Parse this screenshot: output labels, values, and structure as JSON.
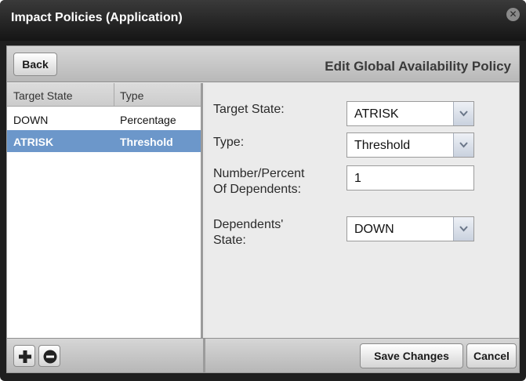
{
  "window": {
    "title": "Impact Policies (Application)",
    "close_icon": "close-icon"
  },
  "toolbar": {
    "back_label": "Back",
    "header_title": "Edit Global Availability Policy"
  },
  "policy_list": {
    "columns": [
      "Target State",
      "Type"
    ],
    "rows": [
      {
        "target_state": "DOWN",
        "type": "Percentage",
        "selected": false
      },
      {
        "target_state": "ATRISK",
        "type": "Threshold",
        "selected": true
      }
    ]
  },
  "form": {
    "target_state": {
      "label": "Target State:",
      "value": "ATRISK"
    },
    "type": {
      "label": "Type:",
      "value": "Threshold"
    },
    "number_percent": {
      "label_line1": "Number/Percent",
      "label_line2": "Of Dependents:",
      "value": "1"
    },
    "dependents_state": {
      "label_line1": "Dependents'",
      "label_line2": "State:",
      "value": "DOWN"
    }
  },
  "footer": {
    "add_icon": "plus-icon",
    "remove_icon": "minus-icon",
    "save_label": "Save Changes",
    "cancel_label": "Cancel"
  },
  "colors": {
    "selection": "#6c97ca",
    "titlebar": "#1f1f1f"
  }
}
